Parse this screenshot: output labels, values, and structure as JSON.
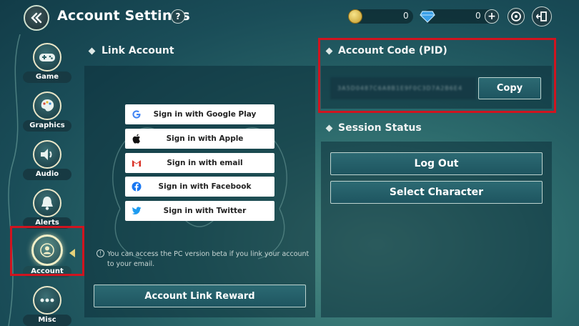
{
  "header": {
    "title": "Account Settings",
    "help_label": "?",
    "coins": "0",
    "gems": "0"
  },
  "sidebar": {
    "items": [
      {
        "label": "Game",
        "icon": "gamepad-icon"
      },
      {
        "label": "Graphics",
        "icon": "palette-icon"
      },
      {
        "label": "Audio",
        "icon": "speaker-icon"
      },
      {
        "label": "Alerts",
        "icon": "bell-icon"
      },
      {
        "label": "Account",
        "icon": "person-icon",
        "active": true
      },
      {
        "label": "Misc",
        "icon": "ellipsis-icon"
      }
    ]
  },
  "link_account": {
    "title": "Link Account",
    "buttons": [
      {
        "label": "Sign in with Google Play",
        "icon": "google-icon"
      },
      {
        "label": "Sign in with Apple",
        "icon": "apple-icon"
      },
      {
        "label": "Sign in with email",
        "icon": "gmail-icon"
      },
      {
        "label": "Sign in with Facebook",
        "icon": "facebook-icon"
      },
      {
        "label": "Sign in with Twitter",
        "icon": "twitter-icon"
      }
    ],
    "note": "You can access the PC version beta if you link your account to your email.",
    "reward_button": "Account Link Reward"
  },
  "account_code": {
    "title": "Account Code (PID)",
    "pid_value": "3A5D0487C6A8B1E9F0C3D7A2B6E4",
    "copy_label": "Copy"
  },
  "session": {
    "title": "Session Status",
    "logout_label": "Log Out",
    "select_character_label": "Select Character"
  },
  "colors": {
    "highlight": "#d0141f",
    "panel_bg": "#0c303a",
    "accent_teal": "#2c6a73"
  }
}
